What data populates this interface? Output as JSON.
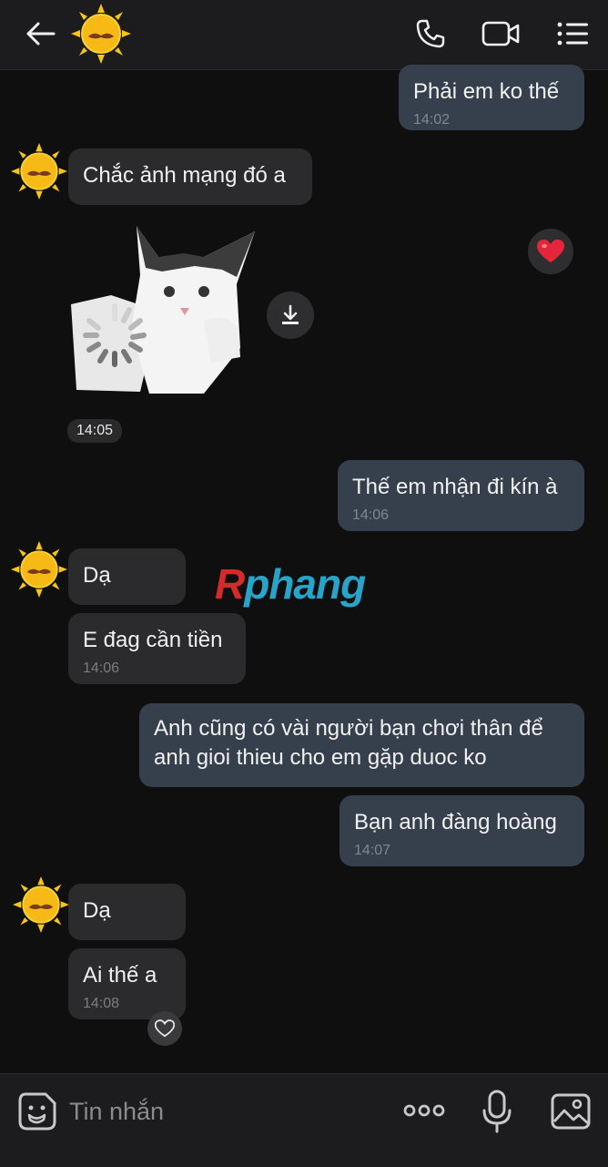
{
  "header": {
    "back": "back-arrow-icon",
    "avatar": "sun-mustache-avatar",
    "actions": [
      "phone-icon",
      "video-icon",
      "menu-icon"
    ]
  },
  "messages": [
    {
      "side": "out",
      "text": "Phải em ko thế",
      "time": "14:02"
    },
    {
      "side": "in",
      "text": "Chắc ảnh mạng đó a",
      "time": ""
    },
    {
      "side": "in",
      "type": "sticker",
      "time": "14:05"
    },
    {
      "side": "out",
      "text": "Thế em nhận đi kín à",
      "time": "14:06"
    },
    {
      "side": "in",
      "text": "Dạ",
      "time": ""
    },
    {
      "side": "in",
      "text": "E đag cần tiền",
      "time": "14:06"
    },
    {
      "side": "out",
      "text": "Anh cũng có vài người bạn chơi thân để\nanh gioi thieu cho em gặp duoc ko",
      "time": ""
    },
    {
      "side": "out",
      "text": "Bạn anh đàng hoàng",
      "time": "14:07"
    },
    {
      "side": "in",
      "text": "Dạ",
      "time": ""
    },
    {
      "side": "in",
      "text": "Ai thế a",
      "time": "14:08"
    }
  ],
  "watermark": {
    "r": "R",
    "rest": "phang"
  },
  "input": {
    "placeholder": "Tin nhắn"
  },
  "colors": {
    "bg": "#0f0f10",
    "incoming": "#2b2b2e",
    "outgoing": "#36404c",
    "sun": "#f5c518"
  }
}
